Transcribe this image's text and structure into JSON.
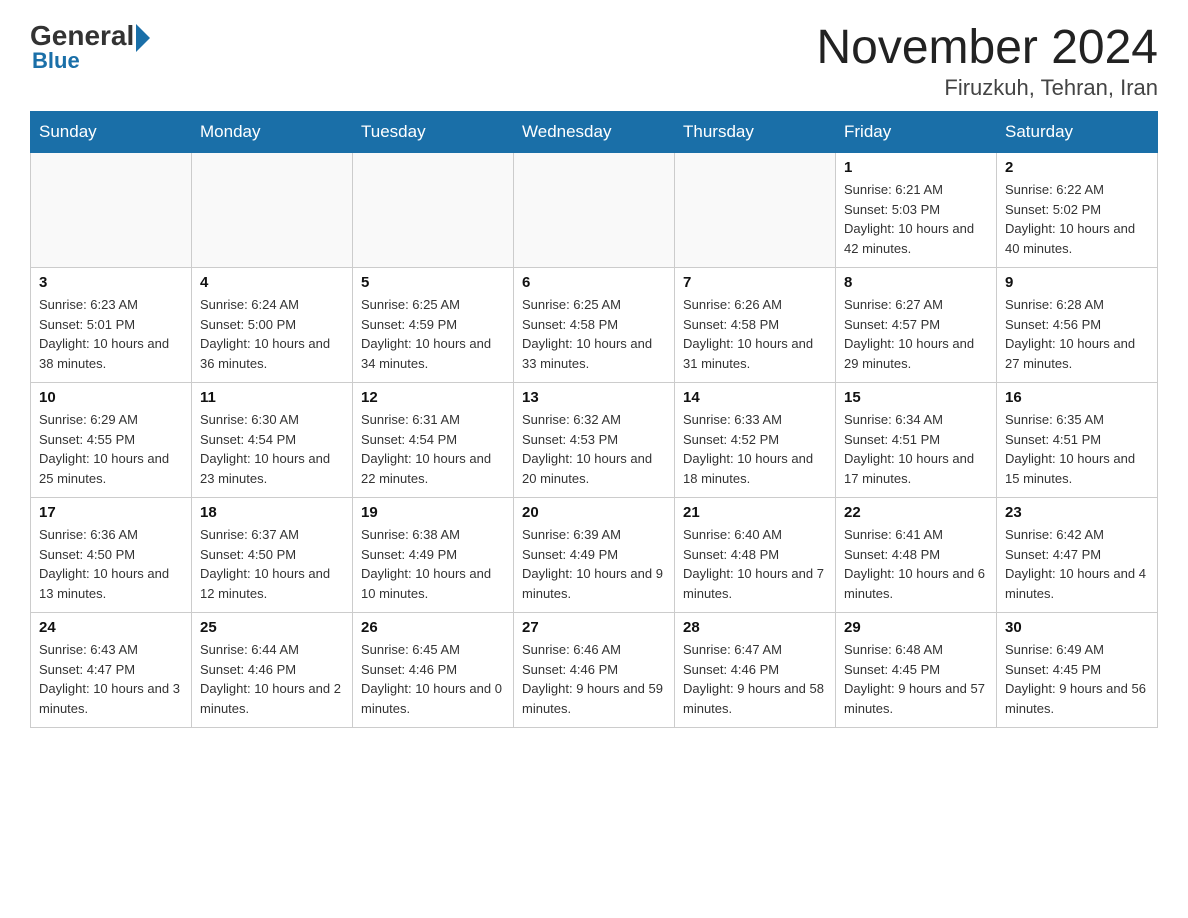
{
  "header": {
    "logo_general": "General",
    "logo_blue": "Blue",
    "month_title": "November 2024",
    "location": "Firuzkuh, Tehran, Iran"
  },
  "weekdays": [
    "Sunday",
    "Monday",
    "Tuesday",
    "Wednesday",
    "Thursday",
    "Friday",
    "Saturday"
  ],
  "weeks": [
    [
      {
        "day": "",
        "info": ""
      },
      {
        "day": "",
        "info": ""
      },
      {
        "day": "",
        "info": ""
      },
      {
        "day": "",
        "info": ""
      },
      {
        "day": "",
        "info": ""
      },
      {
        "day": "1",
        "info": "Sunrise: 6:21 AM\nSunset: 5:03 PM\nDaylight: 10 hours and 42 minutes."
      },
      {
        "day": "2",
        "info": "Sunrise: 6:22 AM\nSunset: 5:02 PM\nDaylight: 10 hours and 40 minutes."
      }
    ],
    [
      {
        "day": "3",
        "info": "Sunrise: 6:23 AM\nSunset: 5:01 PM\nDaylight: 10 hours and 38 minutes."
      },
      {
        "day": "4",
        "info": "Sunrise: 6:24 AM\nSunset: 5:00 PM\nDaylight: 10 hours and 36 minutes."
      },
      {
        "day": "5",
        "info": "Sunrise: 6:25 AM\nSunset: 4:59 PM\nDaylight: 10 hours and 34 minutes."
      },
      {
        "day": "6",
        "info": "Sunrise: 6:25 AM\nSunset: 4:58 PM\nDaylight: 10 hours and 33 minutes."
      },
      {
        "day": "7",
        "info": "Sunrise: 6:26 AM\nSunset: 4:58 PM\nDaylight: 10 hours and 31 minutes."
      },
      {
        "day": "8",
        "info": "Sunrise: 6:27 AM\nSunset: 4:57 PM\nDaylight: 10 hours and 29 minutes."
      },
      {
        "day": "9",
        "info": "Sunrise: 6:28 AM\nSunset: 4:56 PM\nDaylight: 10 hours and 27 minutes."
      }
    ],
    [
      {
        "day": "10",
        "info": "Sunrise: 6:29 AM\nSunset: 4:55 PM\nDaylight: 10 hours and 25 minutes."
      },
      {
        "day": "11",
        "info": "Sunrise: 6:30 AM\nSunset: 4:54 PM\nDaylight: 10 hours and 23 minutes."
      },
      {
        "day": "12",
        "info": "Sunrise: 6:31 AM\nSunset: 4:54 PM\nDaylight: 10 hours and 22 minutes."
      },
      {
        "day": "13",
        "info": "Sunrise: 6:32 AM\nSunset: 4:53 PM\nDaylight: 10 hours and 20 minutes."
      },
      {
        "day": "14",
        "info": "Sunrise: 6:33 AM\nSunset: 4:52 PM\nDaylight: 10 hours and 18 minutes."
      },
      {
        "day": "15",
        "info": "Sunrise: 6:34 AM\nSunset: 4:51 PM\nDaylight: 10 hours and 17 minutes."
      },
      {
        "day": "16",
        "info": "Sunrise: 6:35 AM\nSunset: 4:51 PM\nDaylight: 10 hours and 15 minutes."
      }
    ],
    [
      {
        "day": "17",
        "info": "Sunrise: 6:36 AM\nSunset: 4:50 PM\nDaylight: 10 hours and 13 minutes."
      },
      {
        "day": "18",
        "info": "Sunrise: 6:37 AM\nSunset: 4:50 PM\nDaylight: 10 hours and 12 minutes."
      },
      {
        "day": "19",
        "info": "Sunrise: 6:38 AM\nSunset: 4:49 PM\nDaylight: 10 hours and 10 minutes."
      },
      {
        "day": "20",
        "info": "Sunrise: 6:39 AM\nSunset: 4:49 PM\nDaylight: 10 hours and 9 minutes."
      },
      {
        "day": "21",
        "info": "Sunrise: 6:40 AM\nSunset: 4:48 PM\nDaylight: 10 hours and 7 minutes."
      },
      {
        "day": "22",
        "info": "Sunrise: 6:41 AM\nSunset: 4:48 PM\nDaylight: 10 hours and 6 minutes."
      },
      {
        "day": "23",
        "info": "Sunrise: 6:42 AM\nSunset: 4:47 PM\nDaylight: 10 hours and 4 minutes."
      }
    ],
    [
      {
        "day": "24",
        "info": "Sunrise: 6:43 AM\nSunset: 4:47 PM\nDaylight: 10 hours and 3 minutes."
      },
      {
        "day": "25",
        "info": "Sunrise: 6:44 AM\nSunset: 4:46 PM\nDaylight: 10 hours and 2 minutes."
      },
      {
        "day": "26",
        "info": "Sunrise: 6:45 AM\nSunset: 4:46 PM\nDaylight: 10 hours and 0 minutes."
      },
      {
        "day": "27",
        "info": "Sunrise: 6:46 AM\nSunset: 4:46 PM\nDaylight: 9 hours and 59 minutes."
      },
      {
        "day": "28",
        "info": "Sunrise: 6:47 AM\nSunset: 4:46 PM\nDaylight: 9 hours and 58 minutes."
      },
      {
        "day": "29",
        "info": "Sunrise: 6:48 AM\nSunset: 4:45 PM\nDaylight: 9 hours and 57 minutes."
      },
      {
        "day": "30",
        "info": "Sunrise: 6:49 AM\nSunset: 4:45 PM\nDaylight: 9 hours and 56 minutes."
      }
    ]
  ]
}
